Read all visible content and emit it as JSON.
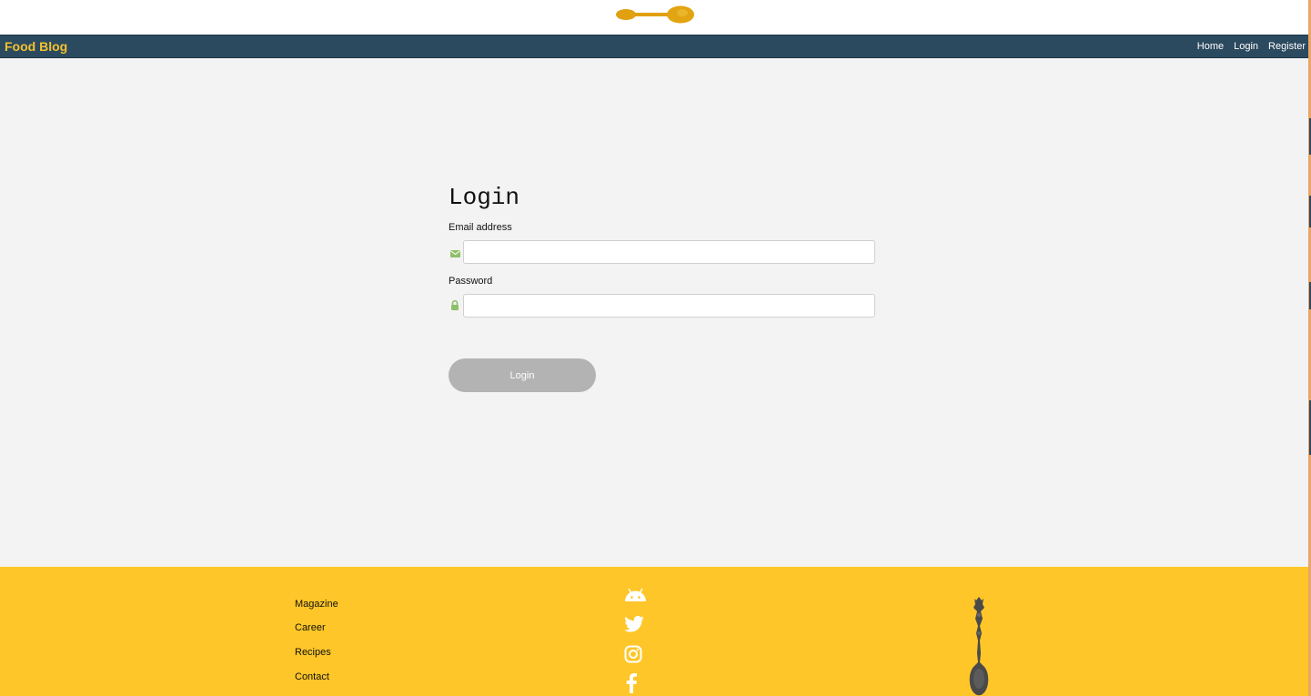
{
  "header": {
    "logo_icon": "spoon-icon",
    "brand": "Food Blog",
    "nav": [
      "Home",
      "Login",
      "Register"
    ],
    "colors": {
      "navbar": "#2c4a5f",
      "brand": "#f5c12e"
    }
  },
  "login": {
    "title": "Login",
    "email_label": "Email address",
    "email_icon": "envelope-icon",
    "email_value": "",
    "password_label": "Password",
    "password_icon": "lock-icon",
    "password_value": "",
    "button_label": "Login",
    "colors": {
      "icon": "#8fbf6a",
      "button": "#b3b3b3"
    }
  },
  "footer": {
    "links": [
      "Magazine",
      "Career",
      "Recipes",
      "Contact"
    ],
    "social_icons": [
      "android-icon",
      "twitter-icon",
      "instagram-icon",
      "facebook-icon"
    ],
    "art_icon": "ornate-spoon-icon",
    "colors": {
      "background": "#fec628"
    }
  }
}
